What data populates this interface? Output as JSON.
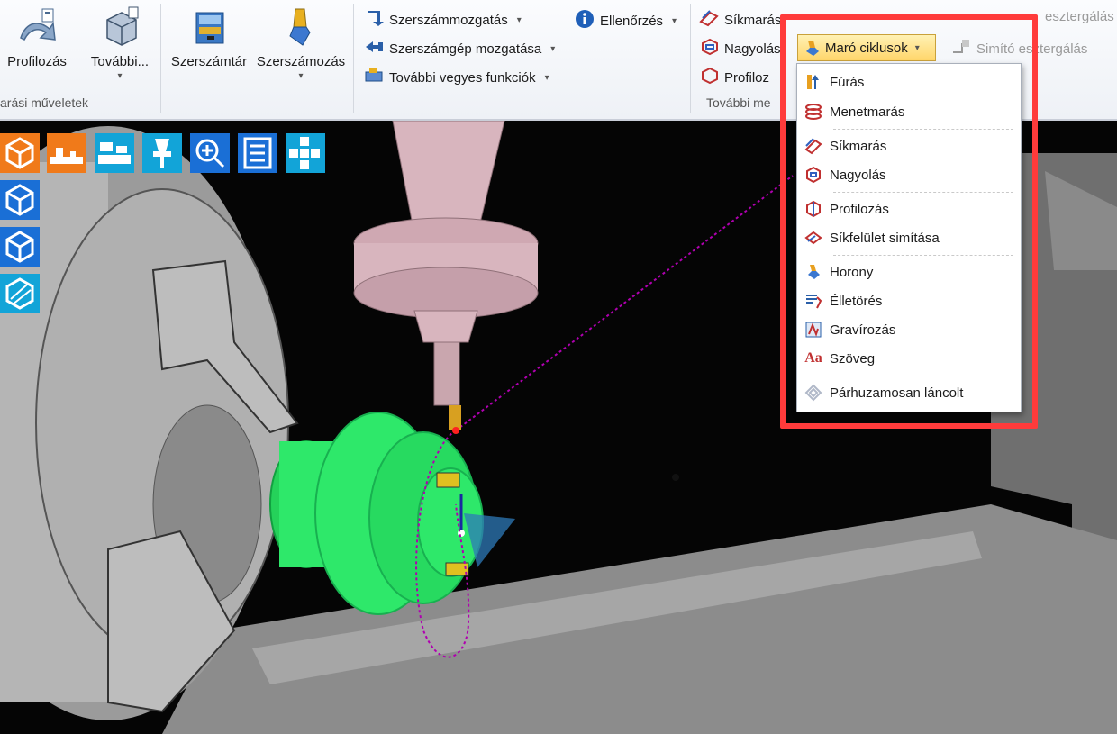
{
  "ribbon": {
    "profilozas": "Profilozás",
    "tovabbi": "További...",
    "group_left": "arási műveletek",
    "szerszamtar": "Szerszámtár",
    "szerszamozas": "Szerszámozás",
    "szerszammozgatas": "Szerszámmozgatás",
    "szerszamgep_mozgatasa": "Szerszámgép mozgatása",
    "tovabbi_vegyes": "További vegyes funkciók",
    "ellenorzes": "Ellenőrzés",
    "sikmaras": "Síkmarás",
    "nagyolas": "Nagyolás",
    "profiloz": "Profiloz",
    "tovabbi_me": "További me",
    "eszterg_top": "esztergálás",
    "simito_eszterg": "Simító esztergálás",
    "maro_ciklusok": "Maró ciklusok"
  },
  "menu": {
    "items": [
      {
        "label": "Fúrás",
        "icon": "drill-icon"
      },
      {
        "label": "Menetmarás",
        "icon": "thread-mill-icon"
      },
      {
        "label": "Síkmarás",
        "icon": "face-mill-icon"
      },
      {
        "label": "Nagyolás",
        "icon": "rough-icon"
      },
      {
        "label": "Profilozás",
        "icon": "profile-icon"
      },
      {
        "label": "Síkfelület simítása",
        "icon": "plane-finish-icon"
      },
      {
        "label": "Horony",
        "icon": "groove-icon"
      },
      {
        "label": "Élletörés",
        "icon": "chamfer-icon"
      },
      {
        "label": "Gravírozás",
        "icon": "engrave-icon"
      },
      {
        "label": "Szöveg",
        "icon": "text-icon",
        "glyph": "Aa"
      },
      {
        "label": "Párhuzamosan láncolt",
        "icon": "parallel-chain-icon",
        "disabled": true
      }
    ]
  },
  "colors": {
    "highlight": "#ff3b3b",
    "part_green": "#2ee86a",
    "toolpath": "#b000b0",
    "tool_holder": "#d8b5be",
    "ribbon_active": "#ffd66a"
  }
}
